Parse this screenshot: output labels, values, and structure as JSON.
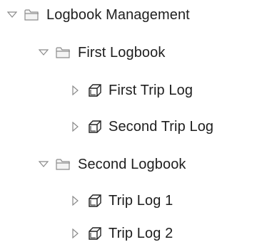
{
  "tree": {
    "root": {
      "label": "Logbook Management",
      "icon": "folder-icon",
      "expanded": true,
      "children": [
        {
          "label": "First Logbook",
          "icon": "folder-icon",
          "expanded": true,
          "children": [
            {
              "label": "First Trip Log",
              "icon": "cube-icon",
              "expanded": false
            },
            {
              "label": "Second Trip Log",
              "icon": "cube-icon",
              "expanded": false
            }
          ]
        },
        {
          "label": "Second Logbook",
          "icon": "folder-icon",
          "expanded": true,
          "children": [
            {
              "label": "Trip Log 1",
              "icon": "cube-icon",
              "expanded": false
            },
            {
              "label": "Trip Log 2",
              "icon": "cube-icon",
              "expanded": false
            }
          ]
        }
      ]
    }
  }
}
